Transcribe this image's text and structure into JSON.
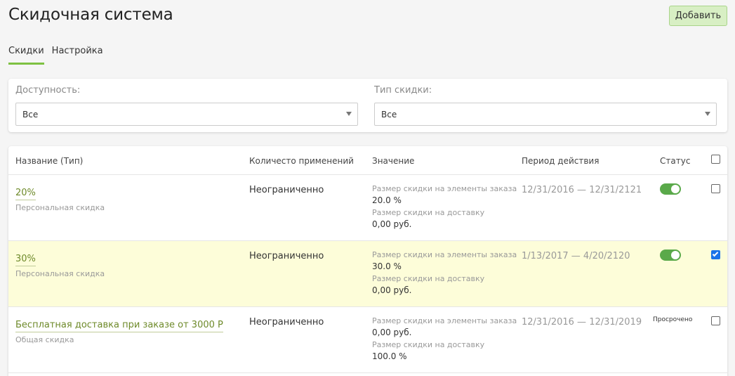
{
  "page": {
    "title": "Скидочная система",
    "add_button": "Добавить"
  },
  "tabs": [
    {
      "label": "Скидки",
      "active": true
    },
    {
      "label": "Настройка",
      "active": false
    }
  ],
  "filters": {
    "availability": {
      "label": "Доступность:",
      "value": "Все"
    },
    "discount_type": {
      "label": "Тип скидки:",
      "value": "Все"
    }
  },
  "table": {
    "headers": {
      "name": "Название (Тип)",
      "usage": "Количесто применений",
      "value": "Значение",
      "period": "Период действия",
      "status": "Статус"
    },
    "rows": [
      {
        "name": "20%",
        "type": "Персональная скидка",
        "usage": "Неограниченно",
        "items_label": "Размер скидки на элементы заказа",
        "items_value": "20.0 %",
        "delivery_label": "Размер скидки на доставку",
        "delivery_value": "0,00 руб.",
        "period": "12/31/2016 — 12/31/2121",
        "status": "active",
        "checked": false
      },
      {
        "name": "30%",
        "type": "Персональная скидка",
        "usage": "Неограниченно",
        "items_label": "Размер скидки на элементы заказа",
        "items_value": "30.0 %",
        "delivery_label": "Размер скидки на доставку",
        "delivery_value": "0,00 руб.",
        "period": "1/13/2017 — 4/20/2120",
        "status": "active",
        "checked": true
      },
      {
        "name": "Бесплатная доставка при заказе от 3000 Р",
        "type": "Общая скидка",
        "usage": "Неограниченно",
        "items_label": "Размер скидки на элементы заказа",
        "items_value": "0,00 руб.",
        "delivery_label": "Размер скидки на доставку",
        "delivery_value": "100.0 %",
        "period": "12/31/2016 — 12/31/2019",
        "status_text": "Просрочено",
        "checked": false
      }
    ]
  },
  "colors": {
    "accent_green": "#7ec142",
    "toggle_on": "#5aa94a",
    "selected_row": "#fdfdd9",
    "checkbox_checked": "#1a73e8"
  }
}
